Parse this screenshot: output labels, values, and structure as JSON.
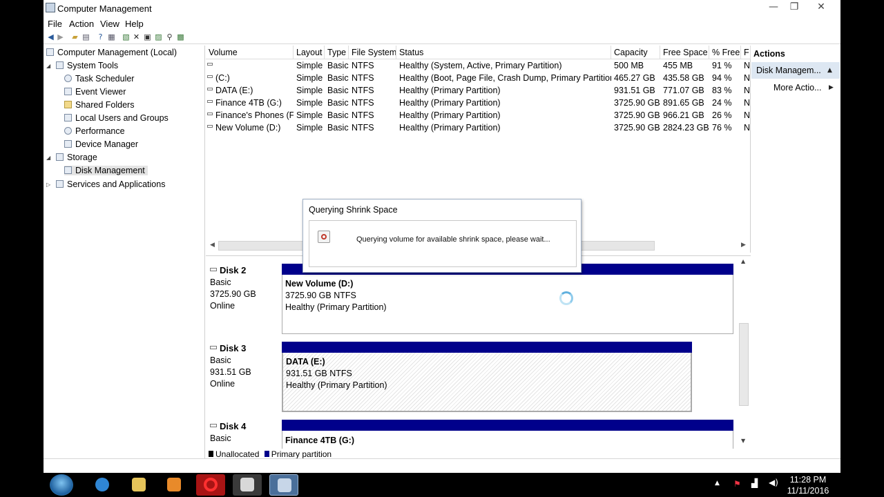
{
  "window": {
    "title": "Computer Management",
    "min_glyph": "—",
    "max_glyph": "❐",
    "close_glyph": "✕"
  },
  "menu": [
    "File",
    "Action",
    "View",
    "Help"
  ],
  "toolbar_icons": [
    "back-arrow-icon",
    "forward-arrow-icon",
    "up-folder-icon",
    "show-hide-tree-icon",
    "help-icon",
    "properties-icon",
    "export-list-icon",
    "delete-icon",
    "settings-icon",
    "refresh-icon",
    "search-icon",
    "zoom-icon"
  ],
  "tree": {
    "root": "Computer Management (Local)",
    "system_tools": "System Tools",
    "task_scheduler": "Task Scheduler",
    "event_viewer": "Event Viewer",
    "shared_folders": "Shared Folders",
    "local_users": "Local Users and Groups",
    "performance": "Performance",
    "device_manager": "Device Manager",
    "storage": "Storage",
    "disk_management": "Disk Management",
    "services": "Services and Applications"
  },
  "columns": [
    "Volume",
    "Layout",
    "Type",
    "File System",
    "Status",
    "Capacity",
    "Free Space",
    "% Free",
    "F"
  ],
  "volumes": [
    {
      "volume": "",
      "layout": "Simple",
      "type": "Basic",
      "fs": "NTFS",
      "status": "Healthy (System, Active, Primary Partition)",
      "capacity": "500 MB",
      "free": "455 MB",
      "pct": "91 %",
      "f": "N"
    },
    {
      "volume": "(C:)",
      "layout": "Simple",
      "type": "Basic",
      "fs": "NTFS",
      "status": "Healthy (Boot, Page File, Crash Dump, Primary Partition)",
      "capacity": "465.27 GB",
      "free": "435.58 GB",
      "pct": "94 %",
      "f": "N"
    },
    {
      "volume": "DATA (E:)",
      "layout": "Simple",
      "type": "Basic",
      "fs": "NTFS",
      "status": "Healthy (Primary Partition)",
      "capacity": "931.51 GB",
      "free": "771.07 GB",
      "pct": "83 %",
      "f": "N"
    },
    {
      "volume": "Finance 4TB (G:)",
      "layout": "Simple",
      "type": "Basic",
      "fs": "NTFS",
      "status": "Healthy (Primary Partition)",
      "capacity": "3725.90 GB",
      "free": "891.65 GB",
      "pct": "24 %",
      "f": "N"
    },
    {
      "volume": "Finance's Phones (F:)",
      "layout": "Simple",
      "type": "Basic",
      "fs": "NTFS",
      "status": "Healthy (Primary Partition)",
      "capacity": "3725.90 GB",
      "free": "966.21 GB",
      "pct": "26 %",
      "f": "N"
    },
    {
      "volume": "New Volume (D:)",
      "layout": "Simple",
      "type": "Basic",
      "fs": "NTFS",
      "status": "Healthy (Primary Partition)",
      "capacity": "3725.90 GB",
      "free": "2824.23 GB",
      "pct": "76 %",
      "f": "N"
    }
  ],
  "disks": [
    {
      "name": "Disk 2",
      "kind": "Basic",
      "size": "3725.90 GB",
      "state": "Online",
      "part_name": "New Volume  (D:)",
      "part_size": "3725.90 GB NTFS",
      "part_status": "Healthy (Primary Partition)"
    },
    {
      "name": "Disk 3",
      "kind": "Basic",
      "size": "931.51 GB",
      "state": "Online",
      "part_name": "DATA  (E:)",
      "part_size": "931.51 GB NTFS",
      "part_status": "Healthy (Primary Partition)"
    },
    {
      "name": "Disk 4",
      "kind": "Basic",
      "part_name": "Finance 4TB  (G:)"
    }
  ],
  "legend": {
    "unallocated": "Unallocated",
    "primary": "Primary partition",
    "unallocated_color": "#000000",
    "primary_color": "#00008b"
  },
  "actions": {
    "header": "Actions",
    "selected": "Disk Managem...",
    "more": "More Actio..."
  },
  "dialog": {
    "title": "Querying Shrink Space",
    "message": "Querying volume for available shrink space, please wait..."
  },
  "taskbar": {
    "apps": [
      "internet-explorer-icon",
      "file-explorer-icon",
      "media-player-icon",
      "opera-icon",
      "paint-icon",
      "computer-management-icon"
    ],
    "time": "11:28 PM",
    "date": "11/11/2016"
  }
}
